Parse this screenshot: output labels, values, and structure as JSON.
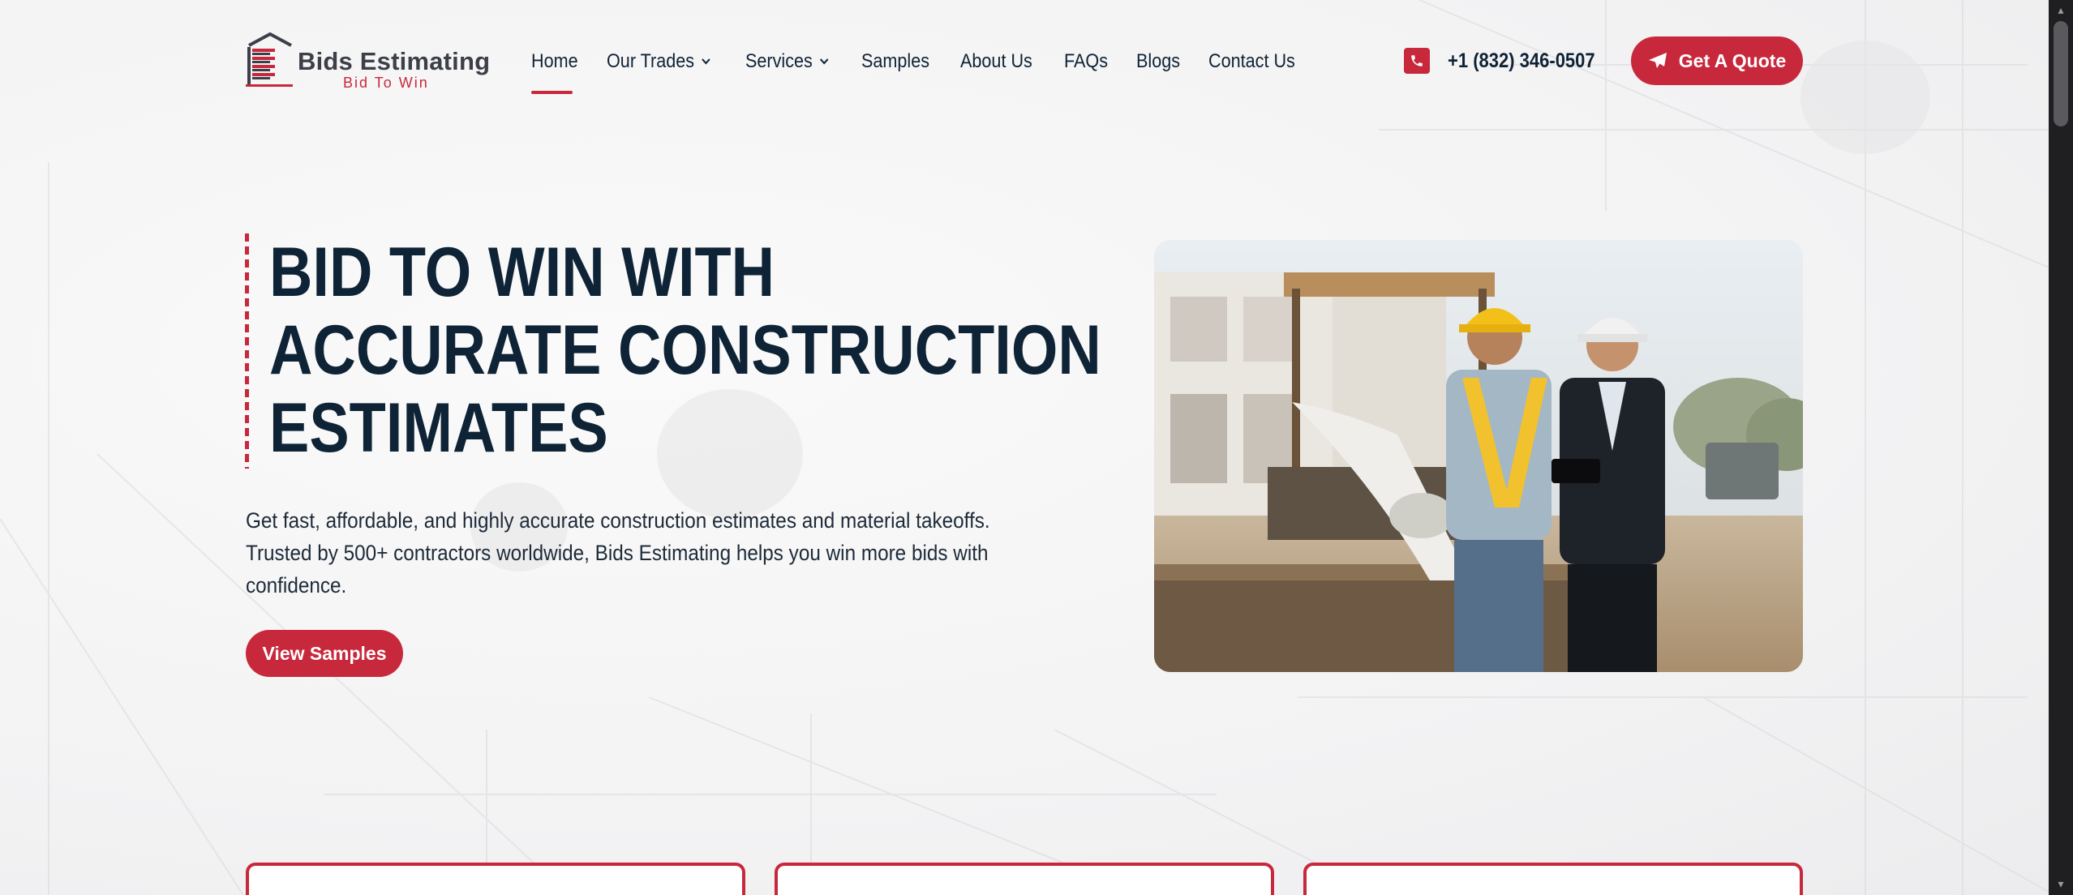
{
  "brand": {
    "name": "Bids Estimating",
    "tagline": "Bid To Win"
  },
  "nav": {
    "items": [
      {
        "label": "Home",
        "active": true,
        "dropdown": false
      },
      {
        "label": "Our Trades",
        "active": false,
        "dropdown": true
      },
      {
        "label": "Services",
        "active": false,
        "dropdown": true
      },
      {
        "label": "Samples",
        "active": false,
        "dropdown": false
      },
      {
        "label": "About Us",
        "active": false,
        "dropdown": false
      },
      {
        "label": "FAQs",
        "active": false,
        "dropdown": false
      },
      {
        "label": "Blogs",
        "active": false,
        "dropdown": false
      },
      {
        "label": "Contact Us",
        "active": false,
        "dropdown": false
      }
    ]
  },
  "contact": {
    "phone": "+1 (832) 346-0507",
    "phone_icon": "phone-icon"
  },
  "header": {
    "quote_label": "Get A Quote",
    "quote_icon": "paper-plane-icon"
  },
  "hero": {
    "title_lines": [
      "BID TO WIN WITH",
      "ACCURATE CONSTRUCTION",
      "ESTIMATES"
    ],
    "description": "Get fast, affordable, and highly accurate construction estimates and material takeoffs. Trusted by 500+ contractors worldwide, Bids Estimating helps you win more bids with confidence.",
    "cta_label": "View Samples",
    "image_alt": "construction-workers-reviewing-blueprint"
  },
  "colors": {
    "accent": "#c8283c",
    "navy": "#0f2336",
    "background": "#f2f2f3"
  }
}
